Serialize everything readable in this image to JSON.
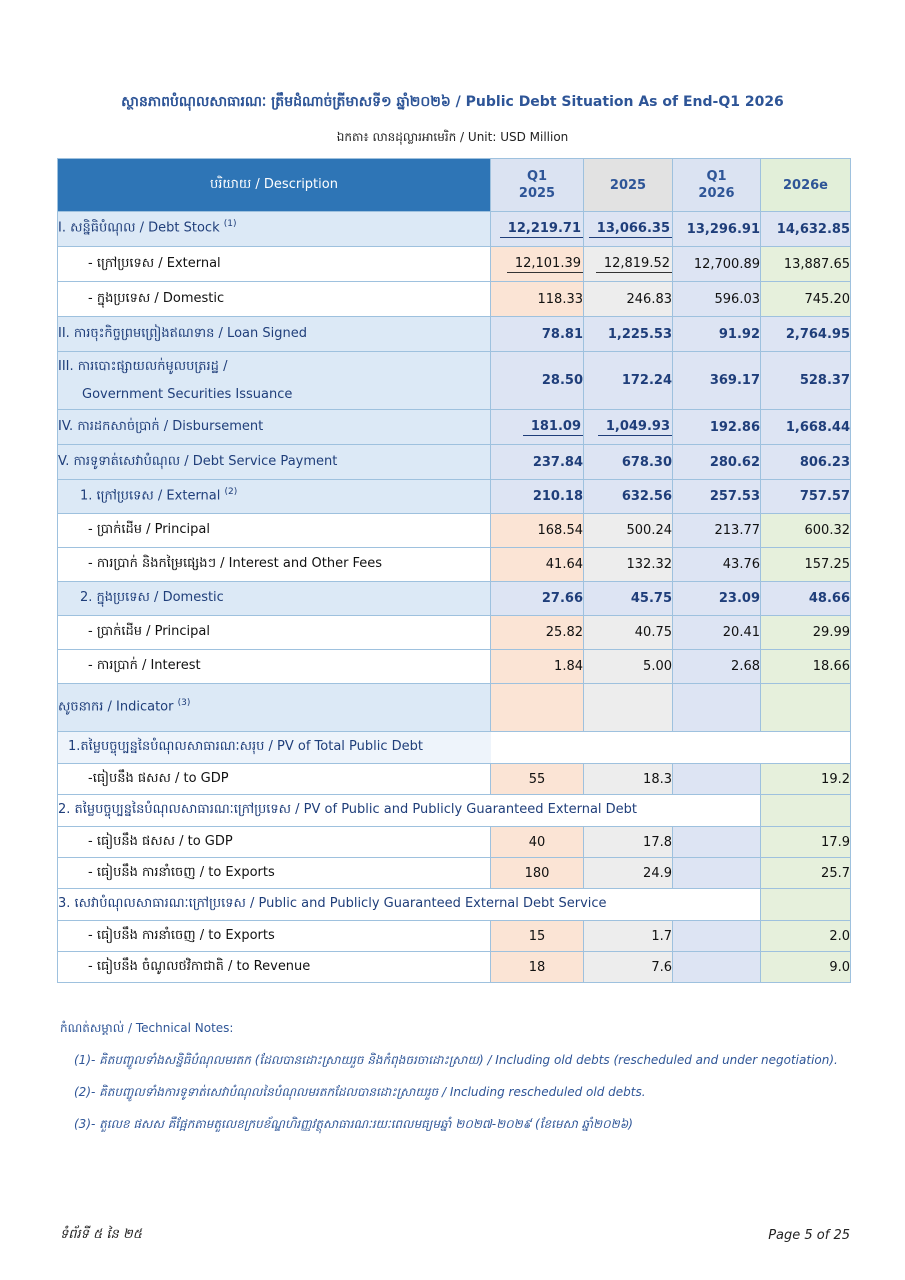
{
  "title": "ស្ថានភាពបំណុលសាធារណៈ ត្រឹមដំណាច់ត្រីមាសទី១ ឆ្នាំ២០២៦ / Public Debt Situation As of End-Q1 2026",
  "unit": "ឯកតា៖ លានដុល្លារអាមេរិក / Unit: USD Million",
  "table": {
    "headers": {
      "description": "បរិយាយ / Description",
      "col1": [
        "Q1",
        "2025"
      ],
      "col2": "2025",
      "col3": [
        "Q1",
        "2026"
      ],
      "col4": "2026e"
    },
    "rows": [
      {
        "label": "I. សន្និធិបំណុល / Debt Stock",
        "sup": "(1)",
        "values": [
          "12,219.71",
          "13,066.35",
          "13,296.91",
          "14,632.85"
        ]
      },
      {
        "label": "- ក្រៅប្រទេស / External",
        "values": [
          "12,101.39",
          "12,819.52",
          "12,700.89",
          "13,887.65"
        ]
      },
      {
        "label": "- ក្នុងប្រទេស / Domestic",
        "values": [
          "118.33",
          "246.83",
          "596.03",
          "745.20"
        ]
      },
      {
        "label": "II. ការចុះកិច្ចព្រមព្រៀងឥណទាន / Loan Signed",
        "values": [
          "78.81",
          "1,225.53",
          "91.92",
          "2,764.95"
        ]
      },
      {
        "label": "III. ការបោះផ្សាយលក់មូលបត្ររដ្ឋ /",
        "label2": "Government Securities Issuance",
        "values": [
          "28.50",
          "172.24",
          "369.17",
          "528.37"
        ]
      },
      {
        "label": "IV. ការដកសាច់ប្រាក់ / Disbursement",
        "values": [
          "181.09",
          "1,049.93",
          "192.86",
          "1,668.44"
        ]
      },
      {
        "label": "V. ការទូទាត់សេវាបំណុល / Debt Service Payment",
        "values": [
          "237.84",
          "678.30",
          "280.62",
          "806.23"
        ]
      },
      {
        "label": "1. ក្រៅប្រទេស / External",
        "sup": "(2)",
        "values": [
          "210.18",
          "632.56",
          "257.53",
          "757.57"
        ]
      },
      {
        "label": "- ប្រាក់ដើម / Principal",
        "values": [
          "168.54",
          "500.24",
          "213.77",
          "600.32"
        ]
      },
      {
        "label": "- ការប្រាក់ និងកម្រៃផ្សេងៗ / Interest and Other Fees",
        "values": [
          "41.64",
          "132.32",
          "43.76",
          "157.25"
        ]
      },
      {
        "label": "2. ក្នុងប្រទេស / Domestic",
        "values": [
          "27.66",
          "45.75",
          "23.09",
          "48.66"
        ]
      },
      {
        "label": "- ប្រាក់ដើម / Principal",
        "values": [
          "25.82",
          "40.75",
          "20.41",
          "29.99"
        ]
      },
      {
        "label": "- ការប្រាក់ / Interest",
        "values": [
          "1.84",
          "5.00",
          "2.68",
          "18.66"
        ]
      }
    ],
    "indicator": {
      "label": "សូចនាករ / Indicator",
      "sup": "(3)",
      "sections": [
        {
          "label": "1.តម្លៃបច្ចុប្បន្ននៃបំណុលសាធារណៈសរុប / PV of Total Public Debt",
          "rows": [
            {
              "label": "-ធៀបនឹង ផសស / to GDP",
              "values": [
                "55",
                "18.3",
                "",
                "19.2"
              ]
            }
          ]
        },
        {
          "label": "2. តម្លៃបច្ចុប្បន្ននៃបំណុលសាធារណៈក្រៅប្រទេស / PV of Public and Publicly Guaranteed External Debt",
          "rows": [
            {
              "label": "- ធៀបនឹង ផសស / to GDP",
              "values": [
                "40",
                "17.8",
                "",
                "17.9"
              ]
            },
            {
              "label": "- ធៀបនឹង ការនាំចេញ / to Exports",
              "values": [
                "180",
                "24.9",
                "",
                "25.7"
              ]
            }
          ]
        },
        {
          "label": "3. សេវាបំណុលសាធារណៈក្រៅប្រទេស / Public and Publicly Guaranteed External Debt Service",
          "rows": [
            {
              "label": "- ធៀបនឹង ការនាំចេញ / to Exports",
              "values": [
                "15",
                "1.7",
                "",
                "2.0"
              ]
            },
            {
              "label": "- ធៀបនឹង ចំណូលថវិកាជាតិ / to Revenue",
              "values": [
                "18",
                "7.6",
                "",
                "9.0"
              ]
            }
          ]
        }
      ]
    }
  },
  "notes": {
    "heading": "កំណត់សម្គាល់ / Technical Notes:",
    "items": [
      "(1)- គិតបញ្ចូលទាំងសន្និធិបំណុលមរតក (ដែលបានដោះស្រាយរួច និងកំពុងចរចាដោះស្រាយ) / Including old debts (rescheduled and under negotiation).",
      "(2)- គិតបញ្ចូលទាំងការទូទាត់សេវាបំណុលនៃបំណុលមរតកដែលបានដោះស្រាយរួច / Including rescheduled old debts.",
      "(3)- តួលេខ ផសស គឺផ្អែកតាមតួលេខក្របខ័ណ្ឌហិរញ្ញវត្ថុសាធារណៈរយៈពេលមធ្យមឆ្នាំ ២០២៧-២០២៩ (ខែមេសា ឆ្នាំ២០២៦)"
    ]
  },
  "footer": {
    "left": "ទំព័រទី ៥ នៃ ២៥",
    "right": "Page 5 of 25"
  }
}
